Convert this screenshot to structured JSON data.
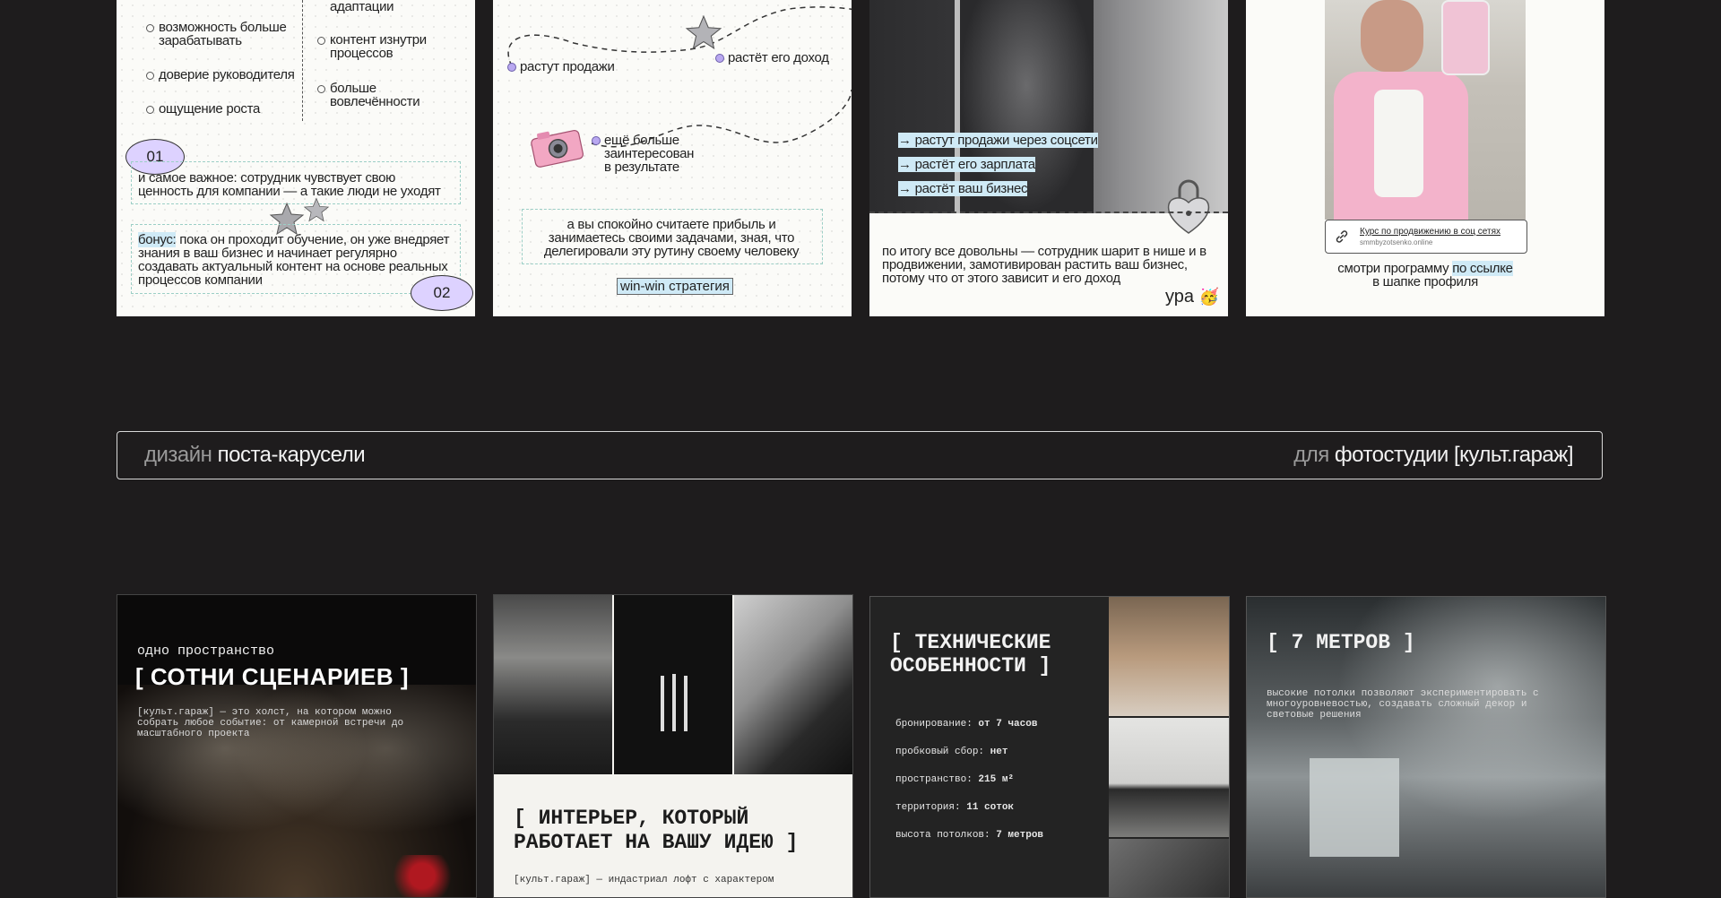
{
  "card1": {
    "left_items": [
      "возможность больше зарабатывать",
      "доверие руководителя",
      "ощущение роста"
    ],
    "right_items": [
      "адаптации",
      "контент изнутри процессов",
      "больше вовлечённости"
    ],
    "badge1": "01",
    "box1_text": "и самое важное: сотрудник чувствует свою ценность для компании — а такие люди не уходят",
    "bonus_label": "бонус:",
    "box2_text": " пока он проходит обучение, он уже внедряет знания в ваш бизнес и начинает регулярно создавать актуальный контент на основе реальных процессов компании",
    "badge2": "02"
  },
  "card2": {
    "label_sales": "растут продажи",
    "label_income": "растёт его доход",
    "label_interest": "ещё больше заинтересован в результате",
    "box_text": "а вы спокойно считаете прибыль и занимаетесь своими задачами, зная, что делегировали эту рутину своему человеку",
    "tag": "win-win стратегия"
  },
  "card3": {
    "arrows": [
      "→ растут продажи через соцсети",
      "→ растёт его зарплата",
      "→ растёт ваш бизнес"
    ],
    "summary": "по итогу все довольны — сотрудник шарит в нише и в продвижении, замотивирован растить ваш бизнес, потому что от этого зависит и его доход",
    "ura": "ура"
  },
  "card4": {
    "link_title": "Курс по продвижению в соц сетях",
    "link_url": "smmbyzotsenko.online",
    "caption_prefix": "смотри программу ",
    "caption_highlight": "по ссылке",
    "caption_suffix": "в шапке профиля"
  },
  "banner": {
    "left_dim": "дизайн ",
    "left_bright": "поста-карусели",
    "right_dim": "для ",
    "right_bright": "фотостудии [культ.гараж]"
  },
  "card5": {
    "small_title": "одно пространство",
    "big_title": "[ СОТНИ СЦЕНАРИЕВ ]",
    "body": "[культ.гараж] — это холст, на котором можно собрать любое событие: от камерной встречи до масштабного проекта"
  },
  "card6": {
    "title": "[ ИНТЕРЬЕР, КОТОРЫЙ РАБОТАЕТ НА ВАШУ ИДЕЮ ]",
    "body": "[культ.гараж] — индастриал лофт с характером"
  },
  "card7": {
    "title": "[ ТЕХНИЧЕСКИЕ ОСОБЕННОСТИ ]",
    "specs": [
      {
        "label": "бронирование: ",
        "value": "от 7 часов"
      },
      {
        "label": "пробковый сбор: ",
        "value": "нет"
      },
      {
        "label": "пространство: ",
        "value": "215 м²"
      },
      {
        "label": "территория: ",
        "value": "11 соток"
      },
      {
        "label": "высота потолков: ",
        "value": "7 метров"
      }
    ]
  },
  "card8": {
    "title": "[ 7 МЕТРОВ ]",
    "body": "высокие потолки позволяют экспериментировать с многоуровневостью, создавать сложный декор и световые решения"
  }
}
